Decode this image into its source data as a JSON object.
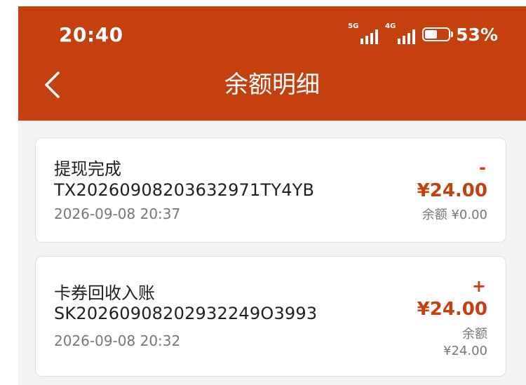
{
  "status_bar": {
    "time": "20:40",
    "signal1_tag": "5G",
    "signal2_tag": "4G",
    "battery_percent": "53%",
    "battery_level": 0.53
  },
  "header": {
    "back_icon": "chevron-left-icon",
    "title": "余额明细",
    "background_color": "#c4410f"
  },
  "records": [
    {
      "title": "提现完成",
      "order_id": "TX20260908203632971TY4YB",
      "time": "2026-09-08 20:37",
      "sign": "-",
      "amount": "¥24.00",
      "balance_label": "余额",
      "balance_value": "¥0.00"
    },
    {
      "title": "卡券回收入账",
      "order_id": "SK20260908202932249O3993",
      "time": "2026-09-08 20:32",
      "sign": "+",
      "amount": "¥24.00",
      "balance_label": "余额",
      "balance_value": "¥24.00"
    }
  ],
  "colors": {
    "accent": "#c4410f",
    "page_background": "#f4f4f4",
    "muted_text": "#777777"
  }
}
